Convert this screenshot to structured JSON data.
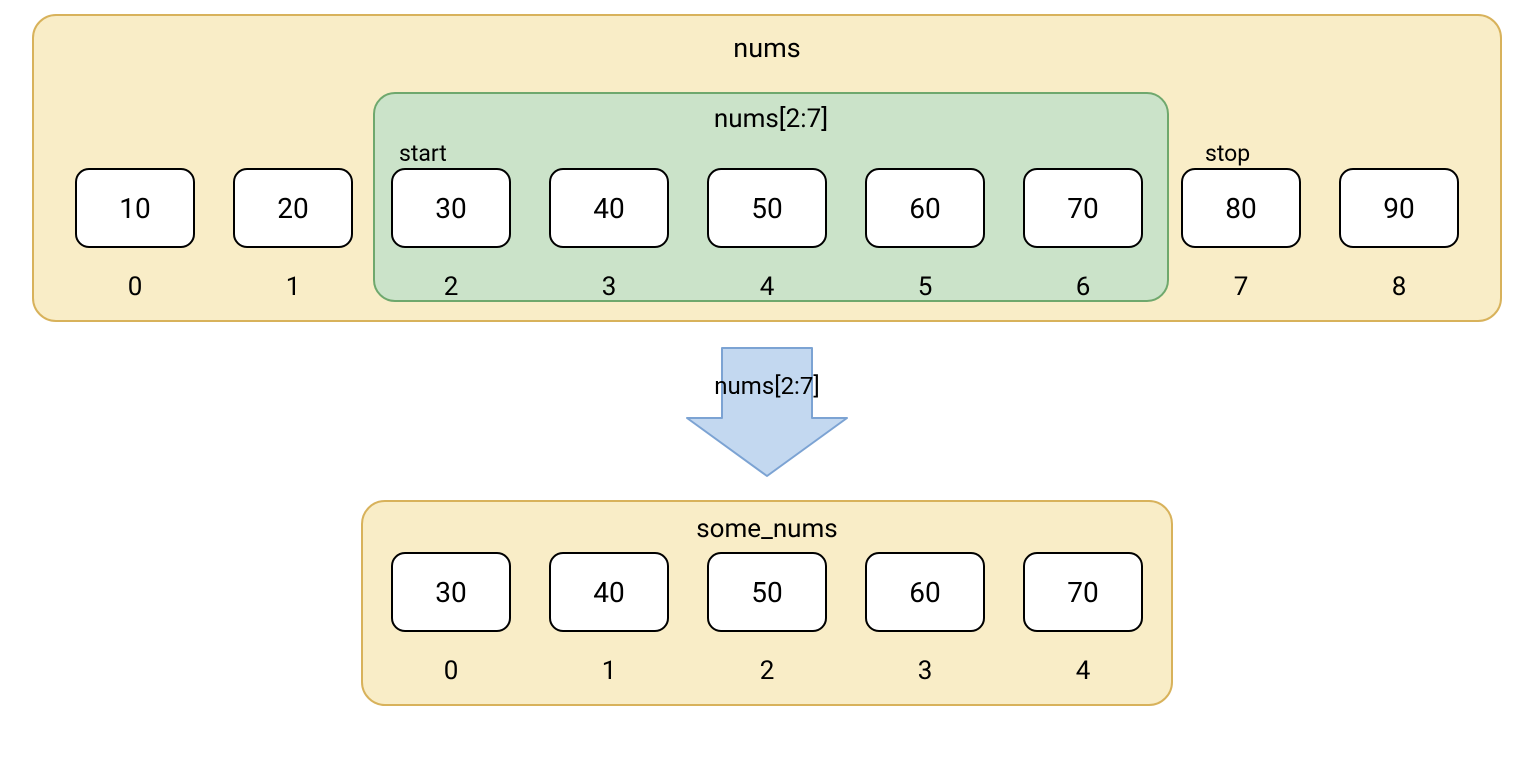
{
  "top": {
    "title": "nums",
    "slice_label": "nums[2:7]",
    "start_label": "start",
    "stop_label": "stop",
    "slice_start_index": 2,
    "slice_stop_index": 7,
    "cells": [
      {
        "value": "10",
        "index": "0"
      },
      {
        "value": "20",
        "index": "1"
      },
      {
        "value": "30",
        "index": "2"
      },
      {
        "value": "40",
        "index": "3"
      },
      {
        "value": "50",
        "index": "4"
      },
      {
        "value": "60",
        "index": "5"
      },
      {
        "value": "70",
        "index": "6"
      },
      {
        "value": "80",
        "index": "7"
      },
      {
        "value": "90",
        "index": "8"
      }
    ]
  },
  "arrow": {
    "label": "nums[2:7]"
  },
  "bottom": {
    "title": "some_nums",
    "cells": [
      {
        "value": "30",
        "index": "0"
      },
      {
        "value": "40",
        "index": "1"
      },
      {
        "value": "50",
        "index": "2"
      },
      {
        "value": "60",
        "index": "3"
      },
      {
        "value": "70",
        "index": "4"
      }
    ]
  },
  "colors": {
    "outer_fill": "#f9edc7",
    "outer_stroke": "#d8b25b",
    "slice_fill": "#cbe3c9",
    "slice_stroke": "#6fa86d",
    "arrow_fill": "#c3d8f0",
    "arrow_stroke": "#7ca3d3"
  }
}
